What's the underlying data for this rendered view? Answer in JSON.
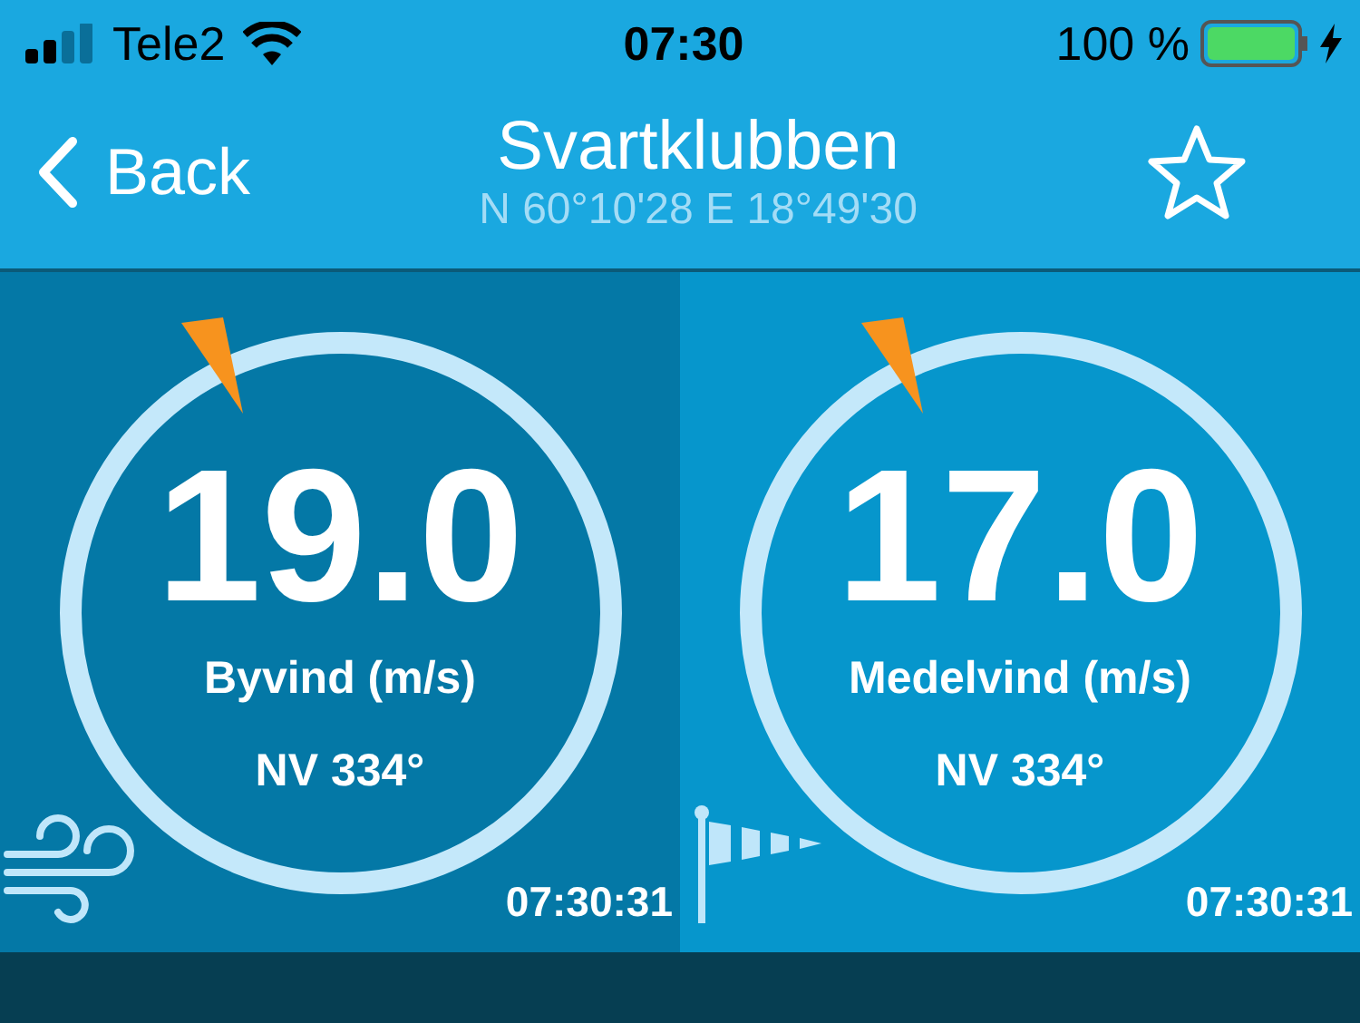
{
  "status_bar": {
    "carrier": "Tele2",
    "time": "07:30",
    "battery": "100 %"
  },
  "nav": {
    "back": "Back",
    "title": "Svartklubben",
    "subtitle": "N 60°10'28 E 18°49'30"
  },
  "tiles": [
    {
      "kind": "gust",
      "value": "19.0",
      "label": "Byvind (m/s)",
      "direction": "NV 334°",
      "time": "07:30:31"
    },
    {
      "kind": "mean",
      "value": "17.0",
      "label": "Medelvind (m/s)",
      "direction": "NV 334°",
      "time": "07:30:31"
    }
  ]
}
